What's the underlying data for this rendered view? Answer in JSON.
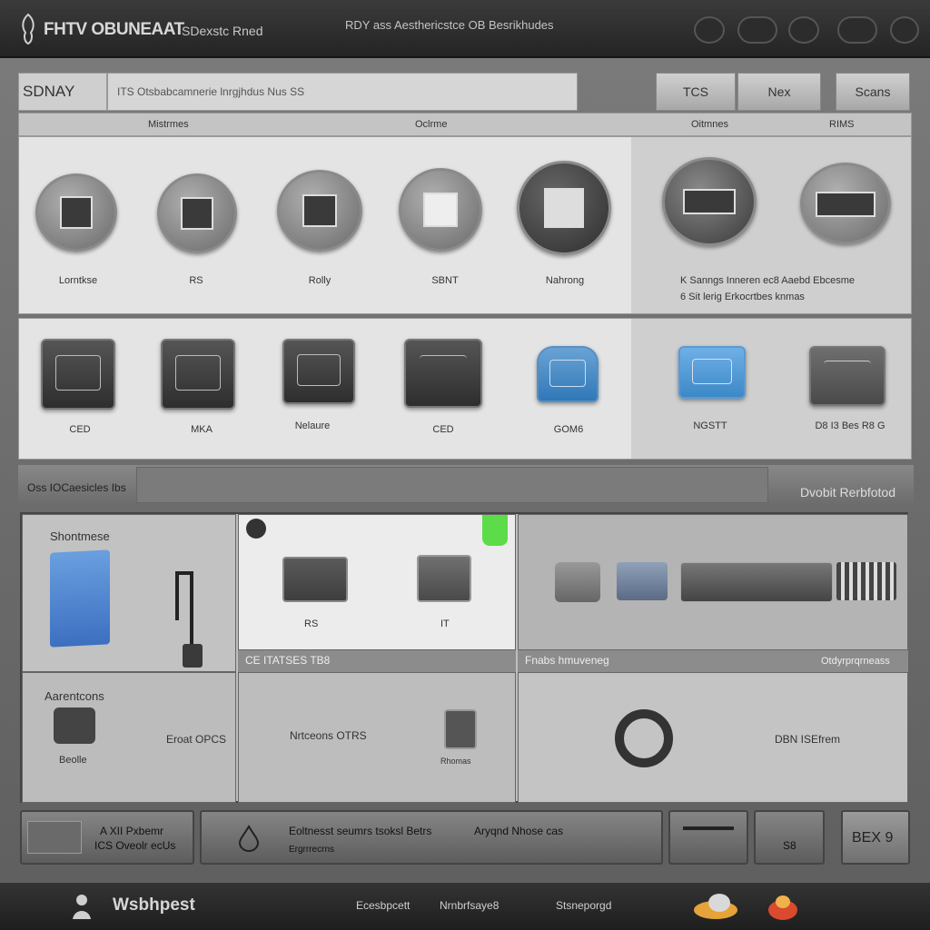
{
  "header": {
    "title": "FHTV OBUNEAAT",
    "subtitle": "SDexstc Rned",
    "tagline": "RDY ass Aesthericstce OB Besrikhudes"
  },
  "toolbar": {
    "search_label": "SDNAY",
    "search_value": "ITS Otsbabcamnerie lnrgjhdus Nus SS",
    "btn1": "TCS",
    "btn2": "Nex",
    "btn3": "Scans"
  },
  "catalog": {
    "headers": [
      "Mistrmes",
      "Oclrme",
      "Oitmnes",
      "RIMS"
    ],
    "row1": [
      "Lorntkse",
      "RS",
      "Rolly",
      "SBNT",
      "Nahrong"
    ],
    "row1_note1": "K Sanngs Inneren ec8 Aaebd Ebcesme",
    "row1_note2": "6 Sit lerig Erkocrtbes knmas",
    "row2": [
      "CED",
      "MKA",
      "Nelaure",
      "CED",
      "GOM6",
      "NGSTT",
      "D8 I3 Bes R8 G"
    ]
  },
  "section": {
    "label": "Oss IOCaesicles Ibs",
    "right": "Dvobit Rerbfotod"
  },
  "grid": {
    "cell1_title": "Shontmese",
    "cell2_labels": [
      "RS",
      "IT"
    ],
    "cell4_title": "Aarentcons",
    "cell4_label": "Beolle",
    "cell4_right": "Eroat OPCS",
    "cell5_head": "CE ITATSES TB8",
    "cell5_text": "Nrtceons OTRS",
    "cell5_small": "Rhomas",
    "cell6_head_left": "Fnabs hmuveneg",
    "cell6_head_right": "Otdyrprqrneass",
    "cell6_text": "DBN ISEfrem"
  },
  "bottom": {
    "b1_line1": "A XII Pxbemr",
    "b1_line2": "ICS Oveolr ecUs",
    "b2_line1": "Eoltnesst seumrs tsoksl Betrs",
    "b2_line2": "Ergrrrecrns",
    "b2_line3": "Aryqnd Nhose cas",
    "b3": "",
    "b4": "S8",
    "b5": "BEX 9"
  },
  "status": {
    "brand": "Wsbhpest",
    "s1": "Ecesbpcett",
    "s2": "Nrnbrfsaye8",
    "s3": "Stsneporgd"
  }
}
